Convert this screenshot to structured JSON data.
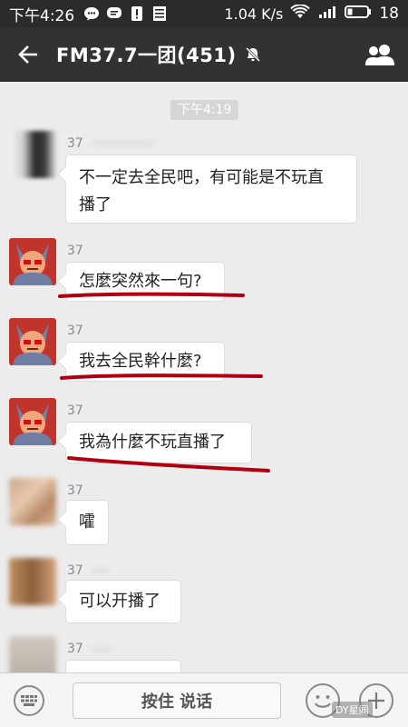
{
  "status_bar": {
    "time": "下午4:26",
    "network_speed": "1.04 K/s",
    "battery": "18"
  },
  "header": {
    "title": "FM37.7一团(451)"
  },
  "chat": {
    "timestamp": "下午4:19",
    "messages": [
      {
        "sender": "37",
        "text_line1": "不一定去全民吧，有可能是不玩直",
        "text_line2": "播了"
      },
      {
        "sender": "37",
        "text": "怎麼突然來一句?"
      },
      {
        "sender": "37",
        "text": "我去全民幹什麼?"
      },
      {
        "sender": "37",
        "text": "我為什麼不玩直播了"
      },
      {
        "sender": "37",
        "text": "嚯"
      },
      {
        "sender": "37",
        "text": "可以开播了"
      },
      {
        "sender": "37",
        "text": ""
      }
    ]
  },
  "input_bar": {
    "talk_label": "按住 说话"
  },
  "watermark": "DY星闻",
  "colors": {
    "status_bg": "#2b2b2b",
    "nav_bg": "#323232",
    "chat_bg": "#ececec",
    "underline": "#b00010"
  }
}
